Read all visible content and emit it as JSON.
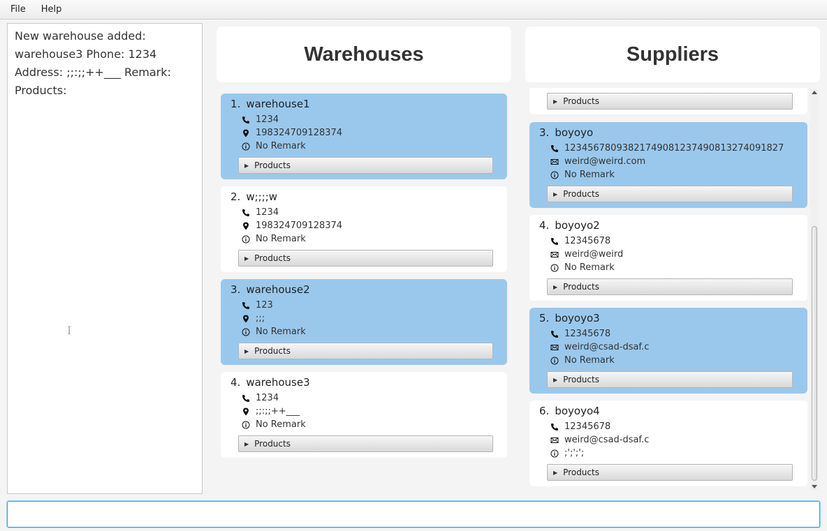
{
  "menu": {
    "file": "File",
    "help": "Help"
  },
  "result": {
    "text": "New warehouse added: warehouse3 Phone: 1234 Address: ;;:;;++___ Remark:  Products:",
    "cursor": "I"
  },
  "warehouses": {
    "header": "Warehouses",
    "items": [
      {
        "idx": "1.",
        "name": "warehouse1",
        "phone": "1234",
        "address": "198324709128374",
        "remark": "No Remark",
        "products": "Products",
        "selected": true
      },
      {
        "idx": "2.",
        "name": "w;;;;w",
        "phone": "1234",
        "address": "198324709128374",
        "remark": "No Remark",
        "products": "Products",
        "selected": false
      },
      {
        "idx": "3.",
        "name": "warehouse2",
        "phone": "123",
        "address": ";;;",
        "remark": "No Remark",
        "products": "Products",
        "selected": true
      },
      {
        "idx": "4.",
        "name": "warehouse3",
        "phone": "1234",
        "address": ";;:;;++___",
        "remark": "No Remark",
        "products": "Products",
        "selected": false
      }
    ]
  },
  "suppliers": {
    "header": "Suppliers",
    "partial_products": "Products",
    "items": [
      {
        "idx": "3.",
        "name": "boyoyo",
        "phone": "12345678093821749081237490813274091827",
        "email": "weird@weird.com",
        "remark": "No Remark",
        "products": "Products",
        "selected": true
      },
      {
        "idx": "4.",
        "name": "boyoyo2",
        "phone": "12345678",
        "email": "weird@weird",
        "remark": "No Remark",
        "products": "Products",
        "selected": false
      },
      {
        "idx": "5.",
        "name": "boyoyo3",
        "phone": "12345678",
        "email": "weird@csad-dsaf.c",
        "remark": "No Remark",
        "products": "Products",
        "selected": true
      },
      {
        "idx": "6.",
        "name": "boyoyo4",
        "phone": "12345678",
        "email": "weird@csad-dsaf.c",
        "remark": ";';';';",
        "products": "Products",
        "selected": false
      }
    ]
  },
  "icons": {
    "phone": "phone-icon",
    "address": "location-pin-icon",
    "email": "envelope-icon",
    "remark": "info-icon",
    "expand": "triangle-right-icon"
  },
  "colors": {
    "selected_card": "#9ac8ed",
    "card": "#ffffff",
    "command_border": "#3aa0d8"
  },
  "command": {
    "value": ""
  }
}
